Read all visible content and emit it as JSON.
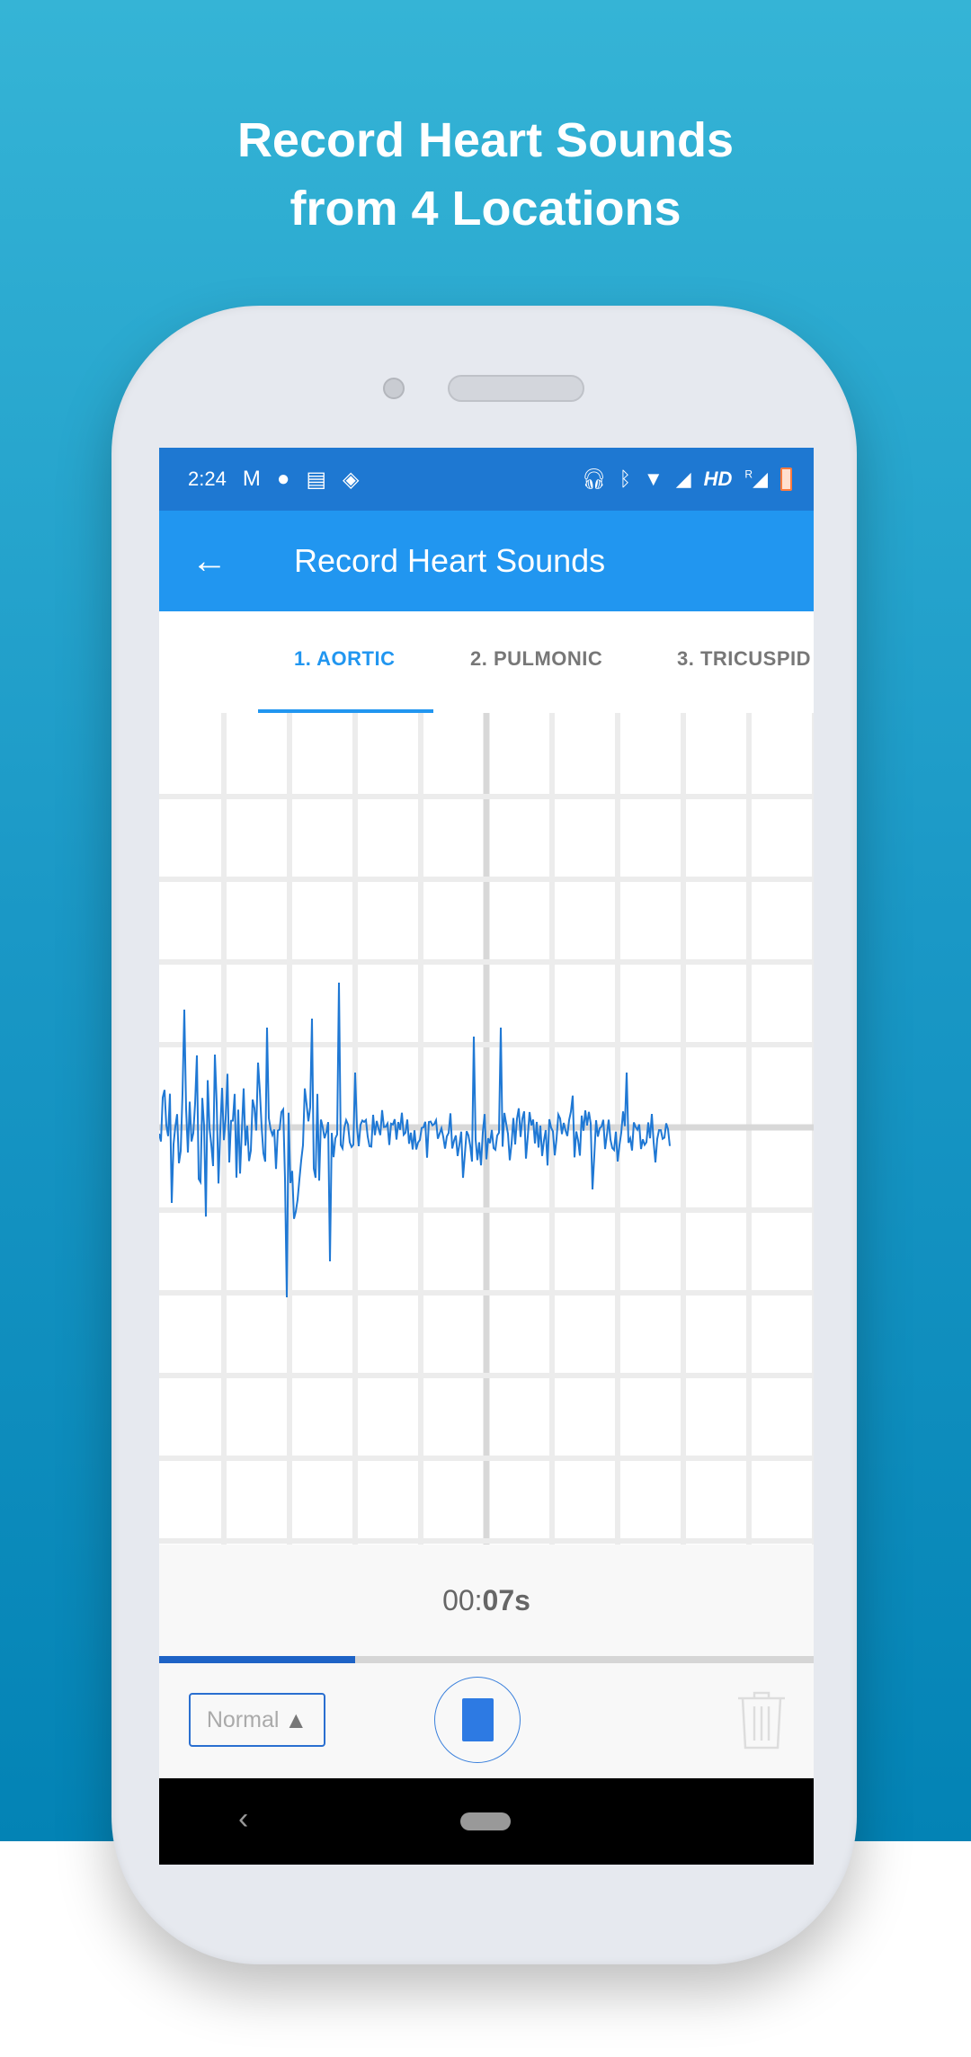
{
  "headline": {
    "line1": "Record Heart Sounds",
    "line2": "from 4 Locations"
  },
  "status_bar": {
    "time": "2:24",
    "icons": [
      "gmail-icon",
      "circle-icon",
      "news-icon",
      "signal-app-icon",
      "headphones-icon",
      "bluetooth-icon",
      "wifi-icon",
      "signal-x-icon",
      "hd-icon",
      "roaming-signal-icon",
      "battery-icon"
    ],
    "hd_label": "HD",
    "roaming_label": "R"
  },
  "toolbar": {
    "title": "Record Heart Sounds"
  },
  "tabs": [
    {
      "label": "1. AORTIC",
      "active": true
    },
    {
      "label": "2. PULMONIC"
    },
    {
      "label": "3. TRICUSPID"
    }
  ],
  "colors": {
    "accent": "#2196f0",
    "status_bar": "#1e78d2",
    "waveform": "#1f78d4"
  },
  "recording": {
    "timer_prefix": "00:",
    "timer_seconds": "07s",
    "progress_percent": 30
  },
  "controls": {
    "speed_label": "Normal"
  }
}
